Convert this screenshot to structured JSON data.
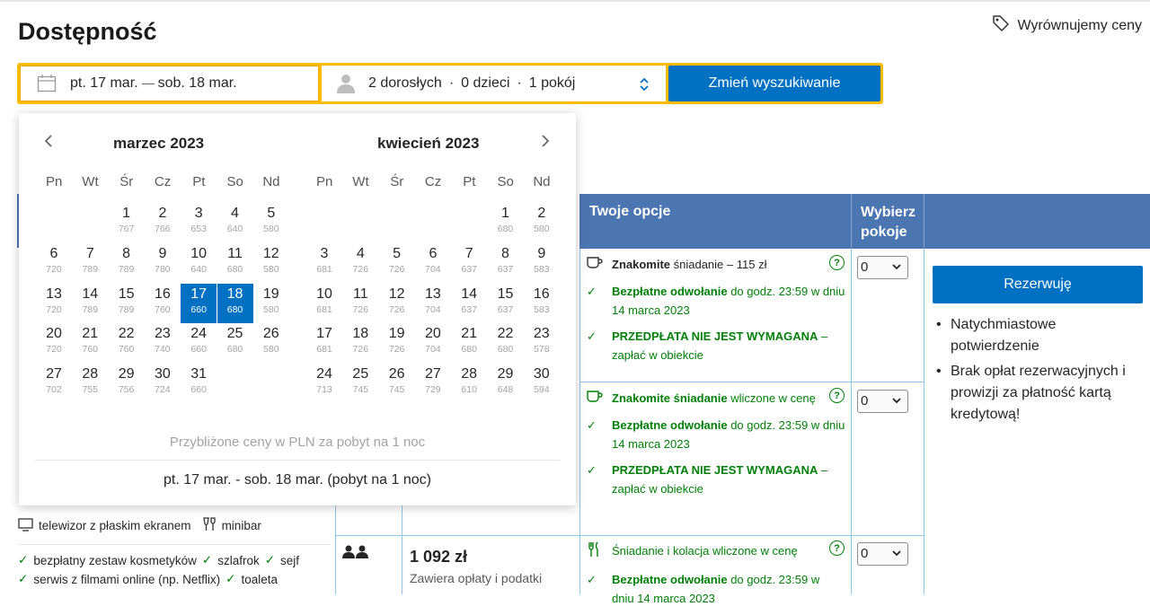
{
  "header": {
    "title": "Dostępność",
    "price_match": "Wyrównujemy ceny"
  },
  "search": {
    "date_from": "pt. 17 mar.",
    "date_to": "sob. 18 mar.",
    "adults": "2 dorosłych",
    "children": "0 dzieci",
    "rooms": "1 pokój",
    "dot": "·",
    "button": "Zmień wyszukiwanie"
  },
  "calendar": {
    "month1": "marzec 2023",
    "month2": "kwiecień 2023",
    "weekdays": [
      "Pn",
      "Wt",
      "Śr",
      "Cz",
      "Pt",
      "So",
      "Nd"
    ],
    "march": [
      {
        "d": "1",
        "p": "767"
      },
      {
        "d": "2",
        "p": "766"
      },
      {
        "d": "3",
        "p": "653"
      },
      {
        "d": "4",
        "p": "640"
      },
      {
        "d": "5",
        "p": "580"
      },
      {
        "d": "6",
        "p": "720"
      },
      {
        "d": "7",
        "p": "789"
      },
      {
        "d": "8",
        "p": "789"
      },
      {
        "d": "9",
        "p": "780"
      },
      {
        "d": "10",
        "p": "640"
      },
      {
        "d": "11",
        "p": "680"
      },
      {
        "d": "12",
        "p": "580"
      },
      {
        "d": "13",
        "p": "720"
      },
      {
        "d": "14",
        "p": "789"
      },
      {
        "d": "15",
        "p": "789"
      },
      {
        "d": "16",
        "p": "760"
      },
      {
        "d": "17",
        "p": "660"
      },
      {
        "d": "18",
        "p": "680"
      },
      {
        "d": "19",
        "p": "580"
      },
      {
        "d": "20",
        "p": "720"
      },
      {
        "d": "21",
        "p": "760"
      },
      {
        "d": "22",
        "p": "760"
      },
      {
        "d": "23",
        "p": "740"
      },
      {
        "d": "24",
        "p": "660"
      },
      {
        "d": "25",
        "p": "680"
      },
      {
        "d": "26",
        "p": "580"
      },
      {
        "d": "27",
        "p": "702"
      },
      {
        "d": "28",
        "p": "755"
      },
      {
        "d": "29",
        "p": "756"
      },
      {
        "d": "30",
        "p": "724"
      },
      {
        "d": "31",
        "p": "660"
      }
    ],
    "april": [
      {
        "d": "1",
        "p": "680"
      },
      {
        "d": "2",
        "p": "580"
      },
      {
        "d": "3",
        "p": "681"
      },
      {
        "d": "4",
        "p": "726"
      },
      {
        "d": "5",
        "p": "726"
      },
      {
        "d": "6",
        "p": "704"
      },
      {
        "d": "7",
        "p": "637"
      },
      {
        "d": "8",
        "p": "637"
      },
      {
        "d": "9",
        "p": "583"
      },
      {
        "d": "10",
        "p": "681"
      },
      {
        "d": "11",
        "p": "726"
      },
      {
        "d": "12",
        "p": "726"
      },
      {
        "d": "13",
        "p": "704"
      },
      {
        "d": "14",
        "p": "637"
      },
      {
        "d": "15",
        "p": "637"
      },
      {
        "d": "16",
        "p": "583"
      },
      {
        "d": "17",
        "p": "681"
      },
      {
        "d": "18",
        "p": "726"
      },
      {
        "d": "19",
        "p": "726"
      },
      {
        "d": "20",
        "p": "704"
      },
      {
        "d": "21",
        "p": "680"
      },
      {
        "d": "22",
        "p": "680"
      },
      {
        "d": "23",
        "p": "578"
      },
      {
        "d": "24",
        "p": "713"
      },
      {
        "d": "25",
        "p": "745"
      },
      {
        "d": "26",
        "p": "745"
      },
      {
        "d": "27",
        "p": "729"
      },
      {
        "d": "28",
        "p": "610"
      },
      {
        "d": "29",
        "p": "648"
      },
      {
        "d": "30",
        "p": "594"
      }
    ],
    "selected": [
      "17",
      "18"
    ],
    "note": "Przybliżone ceny w PLN za pobyt na 1 noc",
    "summary": "pt. 17 mar. - sob. 18 mar. (pobyt na 1 noc)"
  },
  "table": {
    "col_options": "Twoje opcje",
    "col_select_line1": "Wybierz",
    "col_select_line2": "pokoje"
  },
  "options": [
    {
      "meal_bold": "Znakomite",
      "meal_rest": " śniadanie – 115 zł",
      "cancel_bold": "Bezpłatne odwołanie",
      "cancel_rest": " do godz. 23:59 w dniu 14 marca 2023",
      "prepay_bold": "PRZEDPŁATA NIE JEST WYMAGANA",
      "prepay_rest": " – zapłać w obiekcie",
      "select_value": "0"
    },
    {
      "meal_bold": "Znakomite śniadanie",
      "meal_rest": " wliczone w cenę",
      "cancel_bold": "Bezpłatne odwołanie",
      "cancel_rest": " do godz. 23:59 w dniu 14 marca 2023",
      "prepay_bold": "PRZEDPŁATA NIE JEST WYMAGANA",
      "prepay_rest": " – zapłać w obiekcie",
      "select_value": "0"
    },
    {
      "meal_rest": "Śniadanie i kolacja wliczone w cenę",
      "cancel_bold": "Bezpłatne odwołanie",
      "cancel_rest": " do godz. 23:59 w",
      "cancel_cut": "dniu 14 marca 2023",
      "select_value": "0"
    }
  ],
  "price_row": {
    "price": "1 092 zł",
    "sub": "Zawiera opłaty i podatki"
  },
  "reserve": {
    "button": "Rezerwuję",
    "perks": [
      "Natychmiastowe potwierdzenie",
      "Brak opłat rezerwacyjnych i prowizji za płatność kartą kredytową!"
    ]
  },
  "facilities": {
    "tv": "telewizor z płaskim ekranem",
    "minibar": "minibar",
    "kit": "bezpłatny zestaw kosmetyków",
    "robe": "szlafrok",
    "safe": "sejf",
    "streaming": "serwis z filmami online (np. Netflix)",
    "toilet": "toaleta"
  },
  "help_mark": "?",
  "check_mark": "✓"
}
